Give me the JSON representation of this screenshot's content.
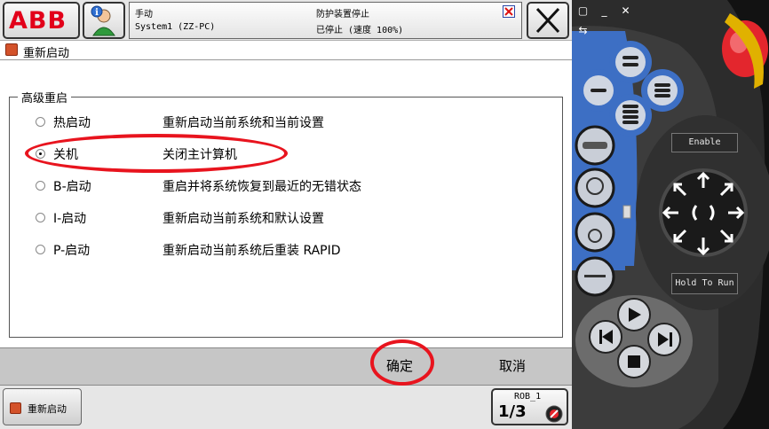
{
  "topbar": {
    "logo": "ABB",
    "status": {
      "mode": "手动",
      "system": "System1 (ZZ-PC)",
      "safety": "防护装置停止",
      "state": "已停止 (速度 100%)"
    }
  },
  "window": {
    "title": "重新启动"
  },
  "group": {
    "label": "高级重启",
    "options": [
      {
        "name": "热启动",
        "desc": "重新启动当前系统和当前设置",
        "checked": false
      },
      {
        "name": "关机",
        "desc": "关闭主计算机",
        "checked": true
      },
      {
        "name": "B-启动",
        "desc": "重启并将系统恢复到最近的无错状态",
        "checked": false
      },
      {
        "name": "I-启动",
        "desc": "重新启动当前系统和默认设置",
        "checked": false
      },
      {
        "name": "P-启动",
        "desc": "重新启动当前系统后重装 RAPID",
        "checked": false
      }
    ]
  },
  "actions": {
    "ok": "确定",
    "cancel": "取消"
  },
  "taskbar": {
    "item": "重新启动",
    "rob_label": "ROB_1",
    "rob_fraction": "1/3"
  },
  "device": {
    "enable_label": "Enable",
    "hold_label": "Hold To Run"
  },
  "colors": {
    "abb_red": "#e2001a",
    "highlight_red": "#e8141e",
    "device_blue": "#3d6fc4",
    "emergency_red": "#e3262d"
  },
  "icons": [
    "info-user-icon",
    "safety-status-icon",
    "close-icon",
    "restart-window-icon",
    "rob-mode-icon"
  ]
}
